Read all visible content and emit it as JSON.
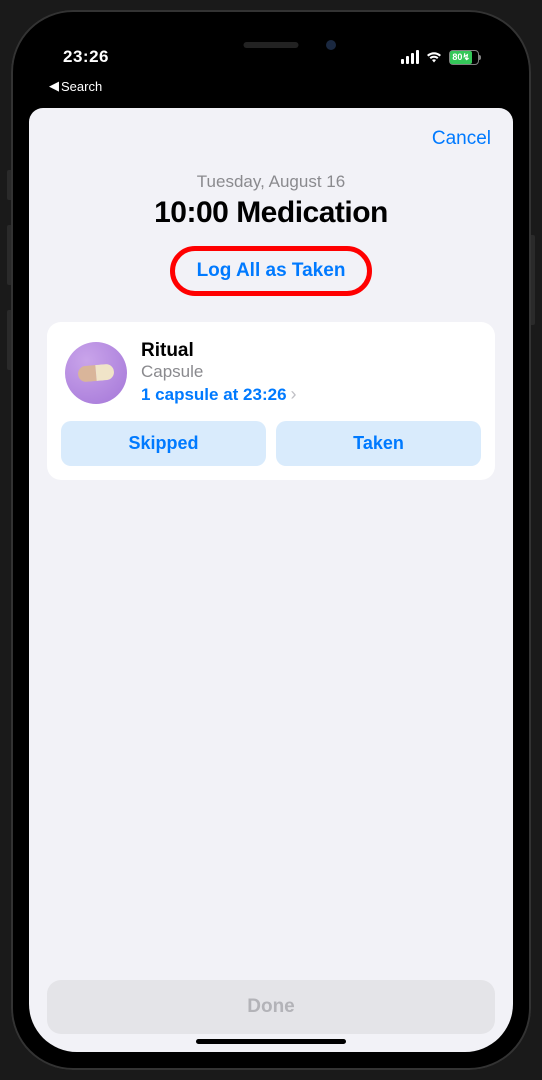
{
  "status": {
    "time": "23:26",
    "back_label": "Search",
    "battery_pct": "80"
  },
  "sheet": {
    "cancel_label": "Cancel",
    "date_label": "Tuesday, August 16",
    "title": "10:00 Medication",
    "log_all_label": "Log All as Taken",
    "done_label": "Done"
  },
  "medication": {
    "name": "Ritual",
    "form": "Capsule",
    "dose_text": "1 capsule at 23:26",
    "skipped_label": "Skipped",
    "taken_label": "Taken"
  }
}
